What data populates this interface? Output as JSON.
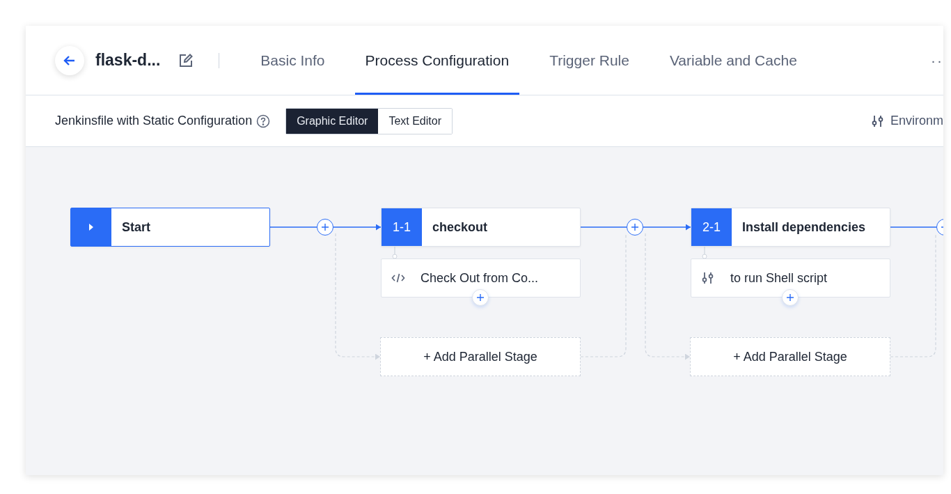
{
  "header": {
    "title": "flask-d...",
    "tabs": [
      {
        "label": "Basic Info",
        "selected": false
      },
      {
        "label": "Process Configuration",
        "selected": true
      },
      {
        "label": "Trigger Rule",
        "selected": false
      },
      {
        "label": "Variable and Cache",
        "selected": false
      }
    ],
    "more": "··"
  },
  "toolbar": {
    "label": "Jenkinsfile with Static Configuration",
    "editors": [
      {
        "label": "Graphic Editor",
        "selected": true
      },
      {
        "label": "Text Editor",
        "selected": false
      }
    ],
    "environment": "Environm"
  },
  "pipeline": {
    "start": {
      "label": "Start"
    },
    "stages": [
      {
        "badge": "1-1",
        "name": "checkout",
        "steps": [
          {
            "kind": "code",
            "label": "Check Out from Co..."
          }
        ],
        "parallel": "+ Add Parallel Stage"
      },
      {
        "badge": "2-1",
        "name": "Install dependencies",
        "steps": [
          {
            "kind": "shell",
            "label": "to run Shell script"
          }
        ],
        "parallel": "+ Add Parallel Stage"
      }
    ]
  }
}
